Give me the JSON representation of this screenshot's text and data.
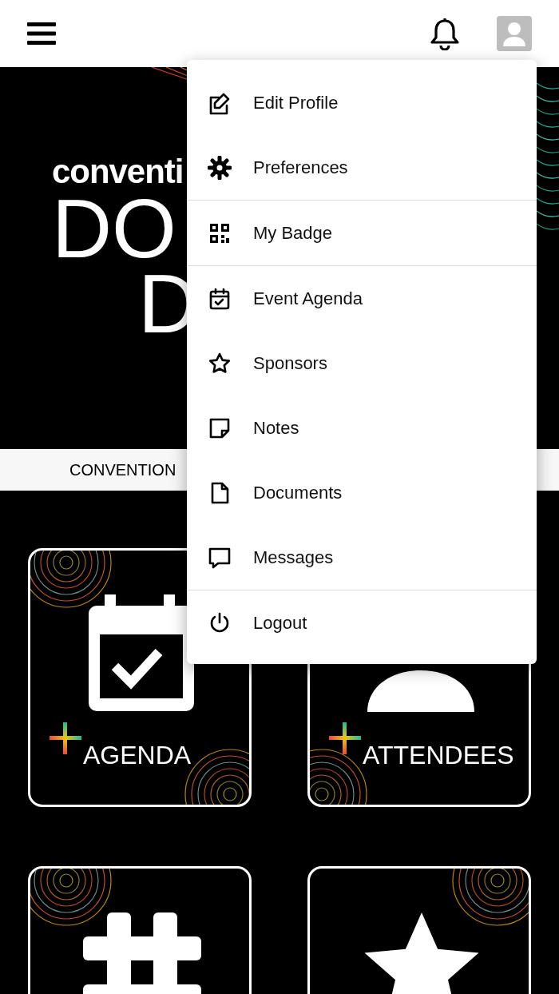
{
  "banner": {
    "texts": [
      "conventi",
      "DO",
      "D"
    ]
  },
  "tab_strip": {
    "label": "CONVENTION"
  },
  "tiles": [
    {
      "kind": "labeled",
      "label": "AGENDA"
    },
    {
      "kind": "labeled",
      "label": "ATTENDEES"
    },
    {
      "kind": "icon_only"
    },
    {
      "kind": "icon_only"
    }
  ],
  "menu": {
    "sections": [
      [
        {
          "label": "Edit Profile"
        },
        {
          "label": "Preferences"
        }
      ],
      [
        {
          "label": "My Badge"
        }
      ],
      [
        {
          "label": "Event Agenda"
        },
        {
          "label": "Sponsors"
        },
        {
          "label": "Notes"
        },
        {
          "label": "Documents"
        },
        {
          "label": "Messages"
        }
      ],
      [
        {
          "label": "Logout"
        }
      ]
    ]
  }
}
